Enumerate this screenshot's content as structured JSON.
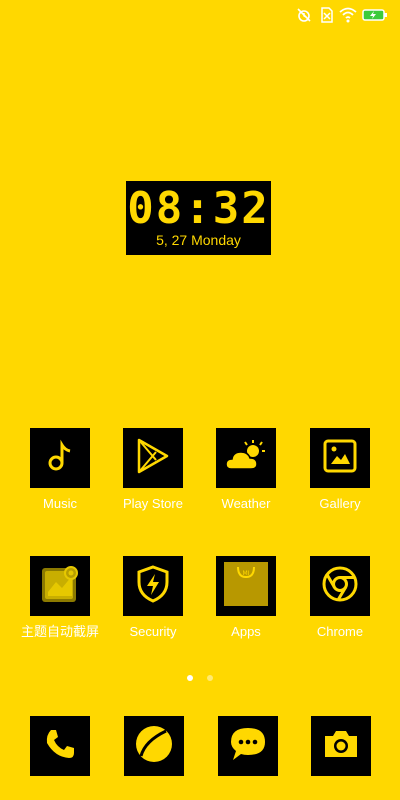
{
  "status_bar": {
    "icons": [
      "alarm-off-icon",
      "sim-off-icon",
      "wifi-icon",
      "battery-charging-icon"
    ],
    "accent_color": "#FFFFFF"
  },
  "clock_widget": {
    "time": "08:32",
    "date": "5, 27 Monday"
  },
  "apps": [
    {
      "label": "Music",
      "icon": "music-note-icon"
    },
    {
      "label": "Play Store",
      "icon": "play-store-icon"
    },
    {
      "label": "Weather",
      "icon": "weather-icon"
    },
    {
      "label": "Gallery",
      "icon": "gallery-icon"
    },
    {
      "label": "主题自动截屏",
      "icon": "theme-screenshot-icon"
    },
    {
      "label": "Security",
      "icon": "security-shield-icon"
    },
    {
      "label": "Apps",
      "icon": "mi-apps-bag-icon"
    },
    {
      "label": "Chrome",
      "icon": "chrome-icon"
    }
  ],
  "page_indicator": {
    "pages": 2,
    "current": 1
  },
  "dock": [
    {
      "icon": "phone-icon"
    },
    {
      "icon": "browser-icon"
    },
    {
      "icon": "messages-icon"
    },
    {
      "icon": "camera-icon"
    }
  ],
  "colors": {
    "background": "#FFD800",
    "tile": "#000000",
    "accent": "#FFD800",
    "label": "#FFFFFF"
  }
}
